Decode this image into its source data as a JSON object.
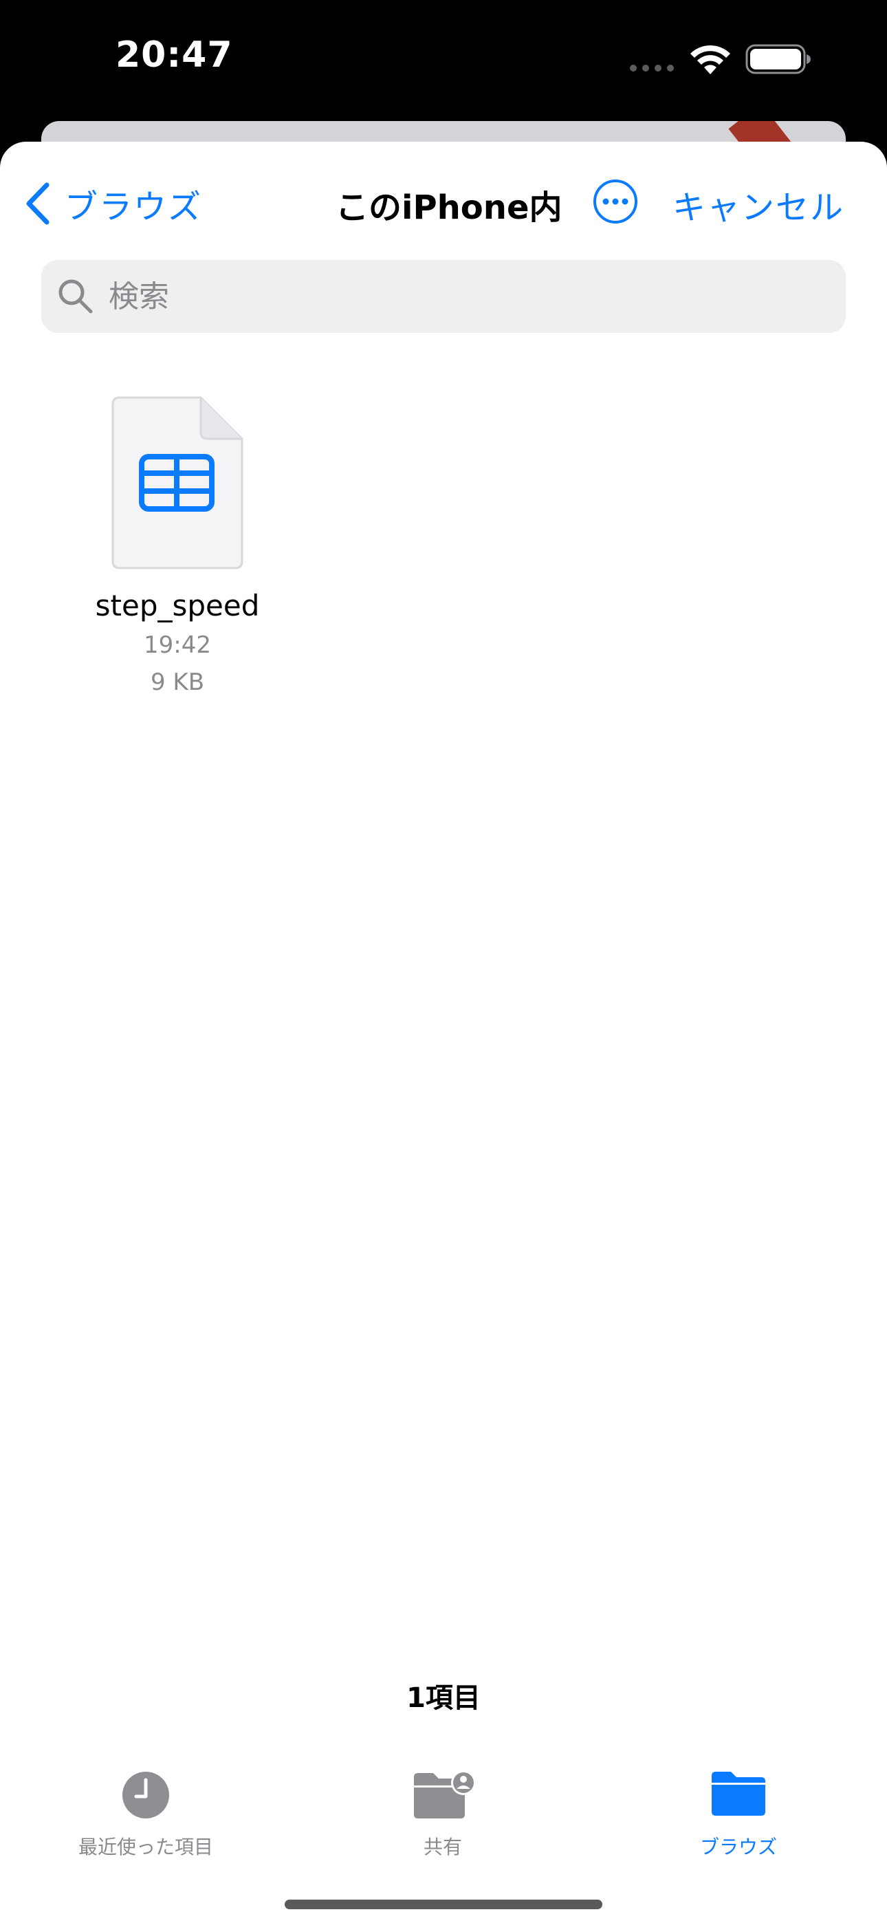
{
  "status_bar": {
    "time": "20:47"
  },
  "nav": {
    "back_label": "ブラウズ",
    "title": "このiPhone内",
    "cancel_label": "キャンセル"
  },
  "search": {
    "placeholder": "検索",
    "value": ""
  },
  "files": [
    {
      "name": "step_speed",
      "time": "19:42",
      "size": "9 KB",
      "icon": "spreadsheet-icon"
    }
  ],
  "item_count": "1項目",
  "tabs": [
    {
      "label": "最近使った項目",
      "icon": "clock-icon",
      "active": false
    },
    {
      "label": "共有",
      "icon": "shared-folder-icon",
      "active": false
    },
    {
      "label": "ブラウズ",
      "icon": "folder-icon",
      "active": true
    }
  ],
  "colors": {
    "accent": "#0a7aff",
    "secondary_text": "#8a8a8e",
    "search_bg": "#efeff0",
    "inactive_icon": "#8e8e93"
  }
}
